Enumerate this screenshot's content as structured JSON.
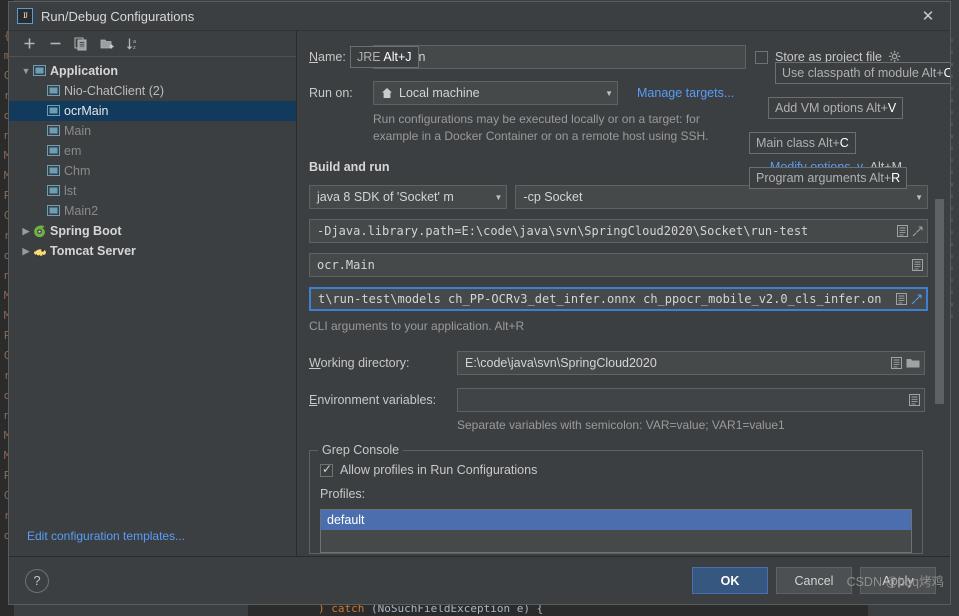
{
  "window": {
    "title": "Run/Debug Configurations",
    "app_icon": "intellij-idea-logo",
    "close_icon": "close-icon"
  },
  "sidebar": {
    "toolbar": [
      {
        "name": "add-configuration-button",
        "icon": "plus-icon"
      },
      {
        "name": "remove-configuration-button",
        "icon": "minus-icon"
      },
      {
        "name": "copy-configuration-button",
        "icon": "copy-icon"
      },
      {
        "name": "new-folder-button",
        "icon": "new-folder-icon"
      },
      {
        "name": "sort-configurations-button",
        "icon": "sort-az-icon"
      }
    ],
    "tree": [
      {
        "label": "Application",
        "level": 0,
        "expanded": true,
        "icon": "application-icon",
        "selected": false,
        "dim": false
      },
      {
        "label": "Nio-ChatClient (2)",
        "level": 1,
        "expanded": null,
        "icon": "application-icon",
        "selected": false,
        "dim": false
      },
      {
        "label": "ocrMain",
        "level": 1,
        "expanded": null,
        "icon": "application-icon",
        "selected": true,
        "dim": false
      },
      {
        "label": "Main",
        "level": 1,
        "expanded": null,
        "icon": "application-icon",
        "selected": false,
        "dim": true
      },
      {
        "label": "em",
        "level": 1,
        "expanded": null,
        "icon": "application-icon",
        "selected": false,
        "dim": true
      },
      {
        "label": "Chm",
        "level": 1,
        "expanded": null,
        "icon": "application-icon",
        "selected": false,
        "dim": true
      },
      {
        "label": "lst",
        "level": 1,
        "expanded": null,
        "icon": "application-icon",
        "selected": false,
        "dim": true
      },
      {
        "label": "Main2",
        "level": 1,
        "expanded": null,
        "icon": "application-icon",
        "selected": false,
        "dim": true
      },
      {
        "label": "Spring Boot",
        "level": 0,
        "expanded": false,
        "icon": "spring-boot-icon",
        "selected": false,
        "dim": false
      },
      {
        "label": "Tomcat Server",
        "level": 0,
        "expanded": false,
        "icon": "tomcat-icon",
        "selected": false,
        "dim": false
      }
    ],
    "edit_templates_label": "Edit configuration templates..."
  },
  "form": {
    "name_label": "Name:",
    "name_value": "ocrMain",
    "store_as_project_file_label": "Store as project file",
    "store_as_project_file_checked": false,
    "store_gear_icon": "gear-icon",
    "run_on_label": "Run on:",
    "run_on_value": "Local machine",
    "run_on_icon": "home-icon",
    "manage_targets_label": "Manage targets...",
    "run_on_hint_line1": "Run configurations may be executed locally or on a target: for",
    "run_on_hint_line2": "example in a Docker Container or on a remote host using SSH.",
    "build_and_run_title": "Build and run",
    "modify_options_label": "Modify options",
    "modify_options_shortcut": "Alt+M",
    "jre_value": "java 8 SDK of 'Socket' m",
    "classpath_value": "-cp Socket",
    "vm_options_value": "-Djava.library.path=E:\\code\\java\\svn\\SpringCloud2020\\Socket\\run-test",
    "main_class_value": "ocr.Main",
    "program_arguments_value": "t\\run-test\\models  ch_PP-OCRv3_det_infer.onnx  ch_ppocr_mobile_v2.0_cls_infer.on",
    "program_arguments_hint": "CLI arguments to your application. Alt+R",
    "working_directory_label": "Working directory:",
    "working_directory_value": "E:\\code\\java\\svn\\SpringCloud2020",
    "environment_variables_label": "Environment variables:",
    "environment_variables_value": "",
    "environment_variables_hint": "Separate variables with semicolon: VAR=value; VAR1=value1"
  },
  "tooltips": [
    {
      "name": "tooltip-jre",
      "text": "JRE ",
      "mnemonic": "Alt+J"
    },
    {
      "name": "tooltip-use-classpath-of-module",
      "text": "Use classpath of module Alt+",
      "mnemonic": "O"
    },
    {
      "name": "tooltip-add-vm-options",
      "text": "Add VM options Alt+",
      "mnemonic": "V"
    },
    {
      "name": "tooltip-main-class",
      "text": "Main class Alt+",
      "mnemonic": "C"
    },
    {
      "name": "tooltip-program-arguments",
      "text": "Program arguments Alt+",
      "mnemonic": "R"
    }
  ],
  "grep_console": {
    "group_title": "Grep Console",
    "allow_profiles_label": "Allow profiles in Run Configurations",
    "allow_profiles_checked": true,
    "profiles_label": "Profiles:",
    "profiles": [
      {
        "label": "default",
        "selected": true
      }
    ]
  },
  "footer": {
    "help_label": "?",
    "ok_label": "OK",
    "cancel_label": "Cancel",
    "apply_label": "Apply"
  },
  "watermark": "CSDN @bbq烤鸡",
  "background": {
    "gutter_chars": "{\nm\nC\nr\no\nn\nM\nM\nP",
    "code_line": ") catch (NoSuchFieldException e) {"
  },
  "colors": {
    "accent_blue": "#589df6",
    "selection_navy": "#113a5c",
    "list_selection": "#4b6eaf",
    "panel_bg": "#3c3f41",
    "field_bg": "#45494a",
    "focus_border": "#3d7fd0",
    "primary_button": "#365880"
  }
}
